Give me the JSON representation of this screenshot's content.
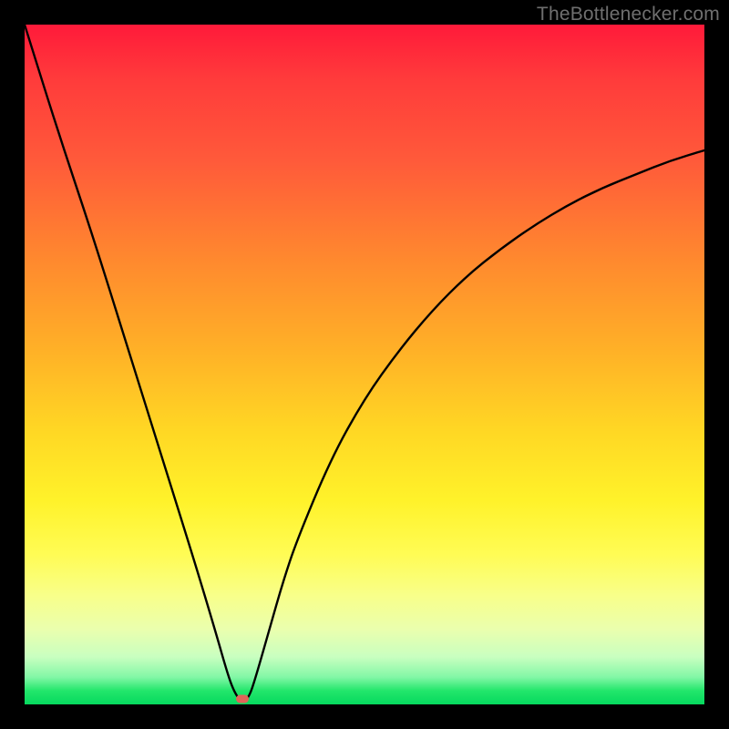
{
  "watermark": "TheBottlenecker.com",
  "chart_data": {
    "type": "line",
    "title": "",
    "xlabel": "",
    "ylabel": "",
    "xlim": [
      0,
      100
    ],
    "ylim": [
      0,
      100
    ],
    "series": [
      {
        "name": "bottleneck-curve",
        "x": [
          0,
          5,
          10,
          15,
          20,
          25,
          28,
          30,
          31,
          32,
          33,
          34,
          36,
          38,
          40,
          45,
          50,
          55,
          60,
          65,
          70,
          75,
          80,
          85,
          90,
          95,
          100
        ],
        "y": [
          100,
          84,
          69,
          53,
          37,
          21,
          11,
          4,
          1.5,
          0.3,
          1,
          4,
          11,
          18,
          24,
          36,
          45,
          52,
          58,
          63,
          67,
          70.5,
          73.5,
          76,
          78,
          80,
          81.5
        ]
      }
    ],
    "marker": {
      "x": 32,
      "y": 0.8,
      "color": "#e06458"
    },
    "gradient_stops": [
      {
        "pos": 0,
        "color": "#ff1a3a"
      },
      {
        "pos": 50,
        "color": "#ffd824"
      },
      {
        "pos": 80,
        "color": "#fff22a"
      },
      {
        "pos": 100,
        "color": "#06d95e"
      }
    ]
  },
  "layout": {
    "image_size": 800,
    "plot_inset": 27
  }
}
